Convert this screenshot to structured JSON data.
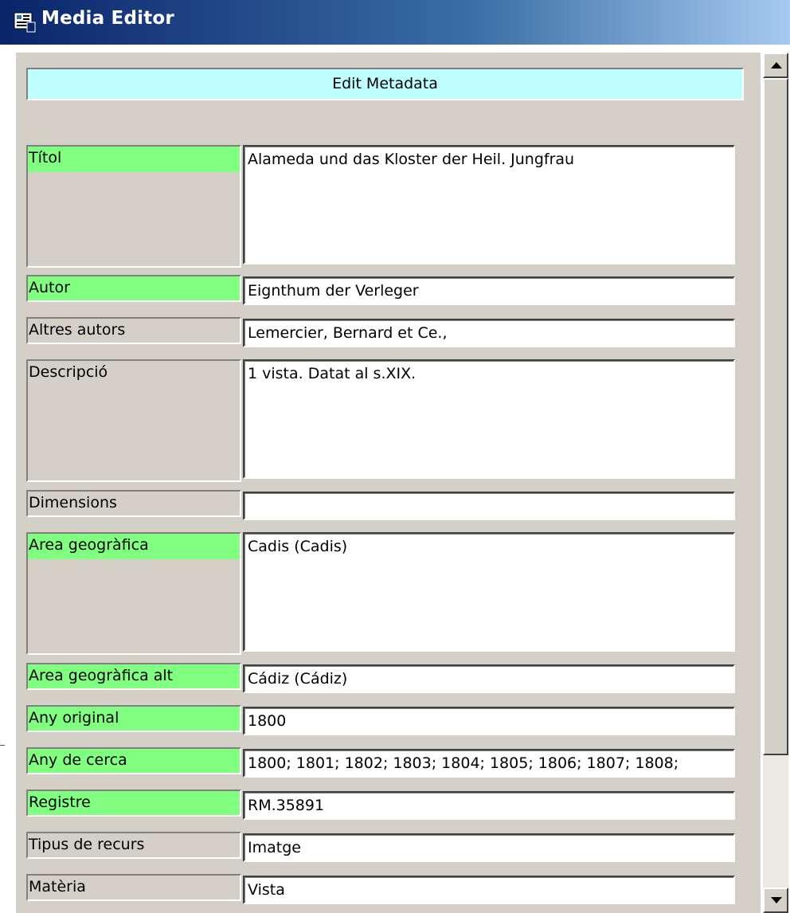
{
  "window": {
    "title": "Media Editor",
    "icon": "media-editor-app-icon"
  },
  "header": {
    "label": "Edit Metadata"
  },
  "fields": [
    {
      "label": "Títol",
      "value": "Alameda und das Kloster der Heil. Jungfrau",
      "required": true
    },
    {
      "label": "Autor",
      "value": "Eignthum der Verleger",
      "required": true
    },
    {
      "label": "Altres autors",
      "value": "Lemercier, Bernard et Ce.,",
      "required": false
    },
    {
      "label": "Descripció",
      "value": "1 vista. Datat al s.XIX.",
      "required": false
    },
    {
      "label": "Dimensions",
      "value": "",
      "required": false
    },
    {
      "label": "Area geogràfica",
      "value": "Cadis (Cadis)",
      "required": true
    },
    {
      "label": "Area geogràfica alt",
      "value": "Cádiz (Cádiz)",
      "required": true
    },
    {
      "label": "Any original",
      "value": "1800",
      "required": true
    },
    {
      "label": "Any de cerca",
      "value": "1800; 1801; 1802; 1803; 1804; 1805; 1806; 1807; 1808;",
      "required": true
    },
    {
      "label": "Registre",
      "value": "RM.35891",
      "required": true
    },
    {
      "label": "Tipus de recurs",
      "value": "Imatge",
      "required": false
    },
    {
      "label": "Matèria",
      "value": "Vista",
      "required": false
    }
  ],
  "colors": {
    "required_label": "#80ff80",
    "optional_label": "#d4d0c8",
    "header_bar": "#bfffff",
    "titlebar_start": "#0a246a"
  },
  "scrollbar": {
    "up_icon": "arrow-up-icon",
    "down_icon": "arrow-down-icon"
  }
}
